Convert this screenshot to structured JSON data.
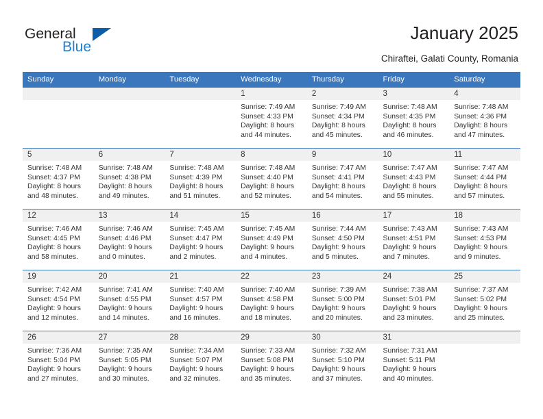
{
  "brand": {
    "name_part1": "General",
    "name_part2": "Blue",
    "flag_icon": "triangle-flag-icon",
    "accent_color": "#1f7fd0",
    "flag_color": "#0d5ca8"
  },
  "header": {
    "title": "January 2025",
    "subtitle": "Chiraftei, Galati County, Romania"
  },
  "calendar": {
    "header_bg": "#3b77bc",
    "header_text_color": "#ffffff",
    "daynum_bg": "#f0f0f0",
    "weekday_headers": [
      "Sunday",
      "Monday",
      "Tuesday",
      "Wednesday",
      "Thursday",
      "Friday",
      "Saturday"
    ],
    "weeks": [
      [
        {
          "day": "",
          "lines": []
        },
        {
          "day": "",
          "lines": []
        },
        {
          "day": "",
          "lines": []
        },
        {
          "day": "1",
          "lines": [
            "Sunrise: 7:49 AM",
            "Sunset: 4:33 PM",
            "Daylight: 8 hours",
            "and 44 minutes."
          ]
        },
        {
          "day": "2",
          "lines": [
            "Sunrise: 7:49 AM",
            "Sunset: 4:34 PM",
            "Daylight: 8 hours",
            "and 45 minutes."
          ]
        },
        {
          "day": "3",
          "lines": [
            "Sunrise: 7:48 AM",
            "Sunset: 4:35 PM",
            "Daylight: 8 hours",
            "and 46 minutes."
          ]
        },
        {
          "day": "4",
          "lines": [
            "Sunrise: 7:48 AM",
            "Sunset: 4:36 PM",
            "Daylight: 8 hours",
            "and 47 minutes."
          ]
        }
      ],
      [
        {
          "day": "5",
          "lines": [
            "Sunrise: 7:48 AM",
            "Sunset: 4:37 PM",
            "Daylight: 8 hours",
            "and 48 minutes."
          ]
        },
        {
          "day": "6",
          "lines": [
            "Sunrise: 7:48 AM",
            "Sunset: 4:38 PM",
            "Daylight: 8 hours",
            "and 49 minutes."
          ]
        },
        {
          "day": "7",
          "lines": [
            "Sunrise: 7:48 AM",
            "Sunset: 4:39 PM",
            "Daylight: 8 hours",
            "and 51 minutes."
          ]
        },
        {
          "day": "8",
          "lines": [
            "Sunrise: 7:48 AM",
            "Sunset: 4:40 PM",
            "Daylight: 8 hours",
            "and 52 minutes."
          ]
        },
        {
          "day": "9",
          "lines": [
            "Sunrise: 7:47 AM",
            "Sunset: 4:41 PM",
            "Daylight: 8 hours",
            "and 54 minutes."
          ]
        },
        {
          "day": "10",
          "lines": [
            "Sunrise: 7:47 AM",
            "Sunset: 4:43 PM",
            "Daylight: 8 hours",
            "and 55 minutes."
          ]
        },
        {
          "day": "11",
          "lines": [
            "Sunrise: 7:47 AM",
            "Sunset: 4:44 PM",
            "Daylight: 8 hours",
            "and 57 minutes."
          ]
        }
      ],
      [
        {
          "day": "12",
          "lines": [
            "Sunrise: 7:46 AM",
            "Sunset: 4:45 PM",
            "Daylight: 8 hours",
            "and 58 minutes."
          ]
        },
        {
          "day": "13",
          "lines": [
            "Sunrise: 7:46 AM",
            "Sunset: 4:46 PM",
            "Daylight: 9 hours",
            "and 0 minutes."
          ]
        },
        {
          "day": "14",
          "lines": [
            "Sunrise: 7:45 AM",
            "Sunset: 4:47 PM",
            "Daylight: 9 hours",
            "and 2 minutes."
          ]
        },
        {
          "day": "15",
          "lines": [
            "Sunrise: 7:45 AM",
            "Sunset: 4:49 PM",
            "Daylight: 9 hours",
            "and 4 minutes."
          ]
        },
        {
          "day": "16",
          "lines": [
            "Sunrise: 7:44 AM",
            "Sunset: 4:50 PM",
            "Daylight: 9 hours",
            "and 5 minutes."
          ]
        },
        {
          "day": "17",
          "lines": [
            "Sunrise: 7:43 AM",
            "Sunset: 4:51 PM",
            "Daylight: 9 hours",
            "and 7 minutes."
          ]
        },
        {
          "day": "18",
          "lines": [
            "Sunrise: 7:43 AM",
            "Sunset: 4:53 PM",
            "Daylight: 9 hours",
            "and 9 minutes."
          ]
        }
      ],
      [
        {
          "day": "19",
          "lines": [
            "Sunrise: 7:42 AM",
            "Sunset: 4:54 PM",
            "Daylight: 9 hours",
            "and 12 minutes."
          ]
        },
        {
          "day": "20",
          "lines": [
            "Sunrise: 7:41 AM",
            "Sunset: 4:55 PM",
            "Daylight: 9 hours",
            "and 14 minutes."
          ]
        },
        {
          "day": "21",
          "lines": [
            "Sunrise: 7:40 AM",
            "Sunset: 4:57 PM",
            "Daylight: 9 hours",
            "and 16 minutes."
          ]
        },
        {
          "day": "22",
          "lines": [
            "Sunrise: 7:40 AM",
            "Sunset: 4:58 PM",
            "Daylight: 9 hours",
            "and 18 minutes."
          ]
        },
        {
          "day": "23",
          "lines": [
            "Sunrise: 7:39 AM",
            "Sunset: 5:00 PM",
            "Daylight: 9 hours",
            "and 20 minutes."
          ]
        },
        {
          "day": "24",
          "lines": [
            "Sunrise: 7:38 AM",
            "Sunset: 5:01 PM",
            "Daylight: 9 hours",
            "and 23 minutes."
          ]
        },
        {
          "day": "25",
          "lines": [
            "Sunrise: 7:37 AM",
            "Sunset: 5:02 PM",
            "Daylight: 9 hours",
            "and 25 minutes."
          ]
        }
      ],
      [
        {
          "day": "26",
          "lines": [
            "Sunrise: 7:36 AM",
            "Sunset: 5:04 PM",
            "Daylight: 9 hours",
            "and 27 minutes."
          ]
        },
        {
          "day": "27",
          "lines": [
            "Sunrise: 7:35 AM",
            "Sunset: 5:05 PM",
            "Daylight: 9 hours",
            "and 30 minutes."
          ]
        },
        {
          "day": "28",
          "lines": [
            "Sunrise: 7:34 AM",
            "Sunset: 5:07 PM",
            "Daylight: 9 hours",
            "and 32 minutes."
          ]
        },
        {
          "day": "29",
          "lines": [
            "Sunrise: 7:33 AM",
            "Sunset: 5:08 PM",
            "Daylight: 9 hours",
            "and 35 minutes."
          ]
        },
        {
          "day": "30",
          "lines": [
            "Sunrise: 7:32 AM",
            "Sunset: 5:10 PM",
            "Daylight: 9 hours",
            "and 37 minutes."
          ]
        },
        {
          "day": "31",
          "lines": [
            "Sunrise: 7:31 AM",
            "Sunset: 5:11 PM",
            "Daylight: 9 hours",
            "and 40 minutes."
          ]
        },
        {
          "day": "",
          "lines": []
        }
      ]
    ]
  }
}
